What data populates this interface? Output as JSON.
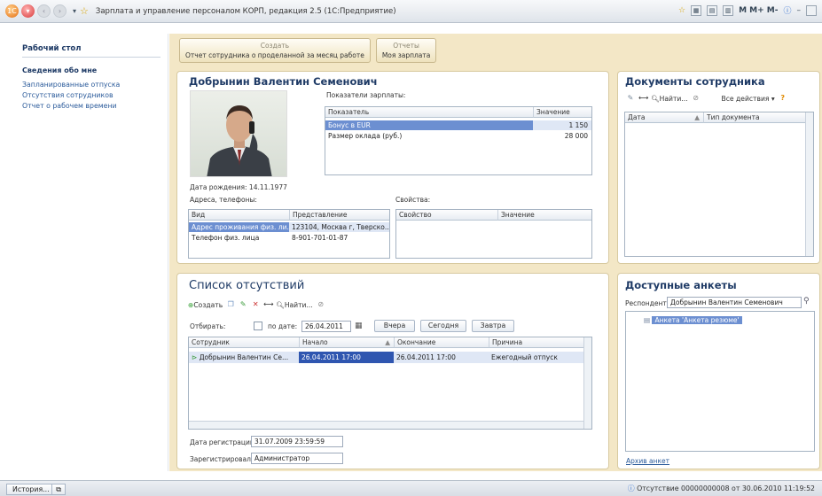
{
  "window": {
    "title": "Зарплата и управление персоналом КОРП, редакция 2.5  (1С:Предприятие)",
    "right_tools": "M  M+  M-"
  },
  "sidebar": {
    "desktop": "Рабочий стол",
    "section": "Сведения обо мне",
    "links": [
      "Запланированные отпуска",
      "Отсутствия сотрудников",
      "Отчет о рабочем времени"
    ]
  },
  "actions": [
    {
      "group": "Создать",
      "item": "Отчет сотрудника о проделанной за месяц работе"
    },
    {
      "group": "Отчеты",
      "item": "Моя зарплата"
    }
  ],
  "employee": {
    "name": "Добрынин Валентин Семенович",
    "salary_caption": "Показатели зарплаты:",
    "salary_headers": [
      "Показатель",
      "Значение"
    ],
    "salary_rows": [
      {
        "name": "Бонус в EUR",
        "value": "1 150"
      },
      {
        "name": "Размер оклада (руб.)",
        "value": "28 000"
      }
    ],
    "birth_label": "Дата рождения:",
    "birth_value": "14.11.1977",
    "addr_caption": "Адреса, телефоны:",
    "addr_headers": [
      "Вид",
      "Представление"
    ],
    "addr_rows": [
      {
        "kind": "Адрес проживания физ. ли...",
        "value": "123104, Москва г, Тверско..."
      },
      {
        "kind": "Телефон физ. лица",
        "value": "8-901-701-01-87"
      }
    ],
    "props_caption": "Свойства:",
    "props_headers": [
      "Свойство",
      "Значение"
    ]
  },
  "documents": {
    "title": "Документы сотрудника",
    "find": "Найти...",
    "all_actions": "Все действия",
    "headers": [
      "Дата",
      "Тип документа"
    ]
  },
  "absences": {
    "title": "Список отсутствий",
    "create": "Создать",
    "find": "Найти...",
    "filter_label": "Отбирать:",
    "by_date": "по дате:",
    "date_value": "26.04.2011",
    "btn_yesterday": "Вчера",
    "btn_today": "Сегодня",
    "btn_tomorrow": "Завтра",
    "headers": [
      "Сотрудник",
      "Начало",
      "Окончание",
      "Причина"
    ],
    "rows": [
      {
        "employee": "Добрынин Валентин Се...",
        "start": "26.04.2011 17:00",
        "end": "26.04.2011 17:00",
        "reason": "Ежегодный отпуск"
      }
    ],
    "reg_date_label": "Дата регистрации:",
    "reg_date_value": "31.07.2009 23:59:59",
    "reg_by_label": "Зарегистрировал:",
    "reg_by_value": "Администратор"
  },
  "forms": {
    "title": "Доступные анкеты",
    "respondent_label": "Респондент:",
    "respondent_value": "Добрынин Валентин Семенович",
    "item": "Анкета 'Анкета резюме'",
    "archive": "Архив анкет"
  },
  "status": {
    "history": "История...",
    "doc": "Отсутствие 00000000008 от 30.06.2010 11:19:52"
  }
}
